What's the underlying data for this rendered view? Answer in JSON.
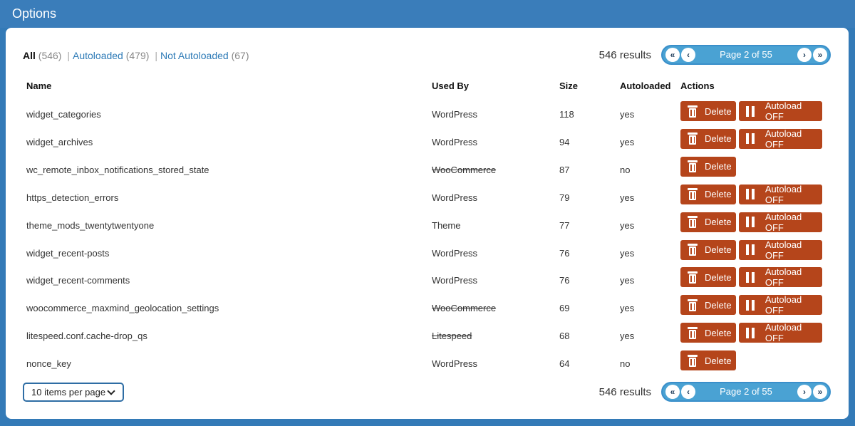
{
  "header": {
    "title": "Options"
  },
  "filters": {
    "all_label": "All",
    "all_count": "(546)",
    "autoloaded_label": "Autoloaded",
    "autoloaded_count": "(479)",
    "not_autoloaded_label": "Not Autoloaded",
    "not_autoloaded_count": "(67)",
    "separator": "|"
  },
  "pagination": {
    "results": "546 results",
    "page_label": "Page 2 of 55",
    "first_icon": "double-chevron-left-icon",
    "prev_icon": "chevron-left-icon",
    "next_icon": "chevron-right-icon",
    "last_icon": "double-chevron-right-icon"
  },
  "table": {
    "headers": {
      "name": "Name",
      "used_by": "Used By",
      "size": "Size",
      "autoloaded": "Autoloaded",
      "actions": "Actions"
    },
    "delete_label": "Delete",
    "autoload_off_label": "Autoload OFF",
    "rows": [
      {
        "name": "widget_categories",
        "used_by": "WordPress",
        "size": "118",
        "autoloaded": "yes"
      },
      {
        "name": "widget_archives",
        "used_by": "WordPress",
        "size": "94",
        "autoloaded": "yes"
      },
      {
        "name": "wc_remote_inbox_notifications_stored_state",
        "used_by": "WooCommerce",
        "size": "87",
        "autoloaded": "no"
      },
      {
        "name": "https_detection_errors",
        "used_by": "WordPress",
        "size": "79",
        "autoloaded": "yes"
      },
      {
        "name": "theme_mods_twentytwentyone",
        "used_by": "Theme",
        "size": "77",
        "autoloaded": "yes"
      },
      {
        "name": "widget_recent-posts",
        "used_by": "WordPress",
        "size": "76",
        "autoloaded": "yes"
      },
      {
        "name": "widget_recent-comments",
        "used_by": "WordPress",
        "size": "76",
        "autoloaded": "yes"
      },
      {
        "name": "woocommerce_maxmind_geolocation_settings",
        "used_by": "WooCommerce",
        "size": "69",
        "autoloaded": "yes"
      },
      {
        "name": "litespeed.conf.cache-drop_qs",
        "used_by": "Litespeed",
        "size": "68",
        "autoloaded": "yes"
      },
      {
        "name": "nonce_key",
        "used_by": "WordPress",
        "size": "64",
        "autoloaded": "no"
      }
    ]
  },
  "per_page": {
    "label": "10 items per page"
  },
  "colors": {
    "header_bg": "#3a7dba",
    "action_button": "#b5451b",
    "pager_bg": "#4aa2d3",
    "link": "#2e7bb7"
  }
}
